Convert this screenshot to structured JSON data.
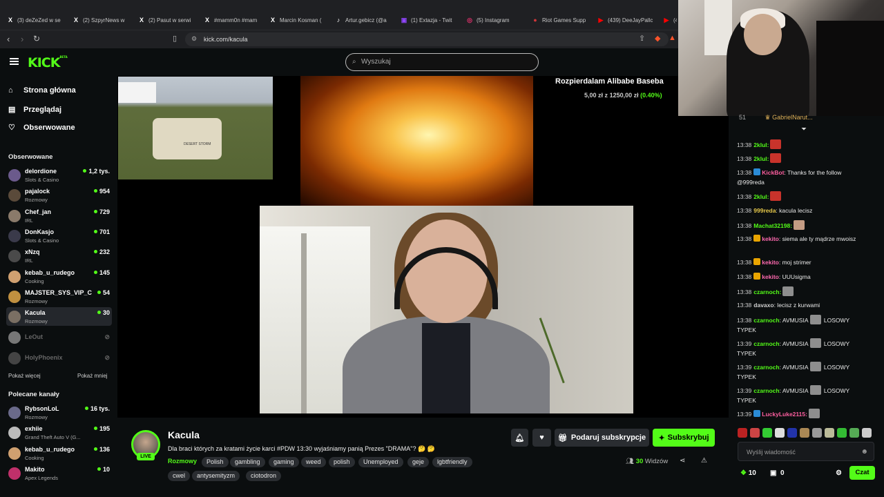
{
  "browser": {
    "tabs": [
      {
        "icon": "X",
        "label": "(3) deZeZed w se"
      },
      {
        "icon": "X",
        "label": "(2) SzpyrNews w"
      },
      {
        "icon": "X",
        "label": "(2) Pasut w serwi"
      },
      {
        "icon": "X",
        "label": "#mamm0n #mam"
      },
      {
        "icon": "X",
        "label": "Marcin Kosman ("
      },
      {
        "icon": "♪",
        "label": "Artur.gebicz (@a"
      },
      {
        "icon": "▣",
        "label": "(1) Extazja - Twit"
      },
      {
        "icon": "◎",
        "label": "(5) Instagram"
      },
      {
        "icon": "●",
        "label": "Riot Games Supp"
      },
      {
        "icon": "▶",
        "label": "(439) DeeJayPallc"
      },
      {
        "icon": "▶",
        "label": "(4"
      }
    ],
    "url": "kick.com/kacula"
  },
  "header": {
    "logo": "KICK",
    "logo_sup": "BETA",
    "search_placeholder": "Wyszukaj"
  },
  "sidebar": {
    "nav": [
      {
        "icon": "⌂",
        "label": "Strona główna"
      },
      {
        "icon": "▤",
        "label": "Przeglądaj"
      },
      {
        "icon": "♡",
        "label": "Obserwowane"
      }
    ],
    "followed_header": "Obserwowane",
    "followed": [
      {
        "name": "delordione",
        "category": "Slots & Casino",
        "viewers": "1,2 tys.",
        "color": "#6b5a8c"
      },
      {
        "name": "pajalock",
        "category": "Rozmowy",
        "viewers": "954",
        "color": "#5a4a3a"
      },
      {
        "name": "Chef_jan",
        "category": "IRL",
        "viewers": "729",
        "color": "#8a7a6a"
      },
      {
        "name": "DonKasjo",
        "category": "Slots & Casino",
        "viewers": "701",
        "color": "#3a3a4a"
      },
      {
        "name": "xNzq",
        "category": "IRL",
        "viewers": "232",
        "color": "#4a4a4a"
      },
      {
        "name": "kebab_u_rudego",
        "category": "Cooking",
        "viewers": "145",
        "color": "#d0a070"
      },
      {
        "name": "MAJSTER_SYS_VIP_C",
        "category": "Rozmowy",
        "viewers": "54",
        "color": "#c09040"
      },
      {
        "name": "Kacula",
        "category": "Rozmowy",
        "viewers": "30",
        "color": "#7a6f63"
      }
    ],
    "offline": [
      {
        "name": "LeOut",
        "color": "#777"
      },
      {
        "name": "HolyPhoenix",
        "color": "#444"
      }
    ],
    "show_more": "Pokaż więcej",
    "show_less": "Pokaż mniej",
    "recommended_header": "Polecane kanały",
    "recommended": [
      {
        "name": "RybsonLoL",
        "category": "Rozmowy",
        "viewers": "16 tys.",
        "color": "#6a6a8a"
      },
      {
        "name": "exhiie",
        "category": "Grand Theft Auto V (G...",
        "viewers": "195",
        "color": "#bbb"
      },
      {
        "name": "kebab_u_rudego",
        "category": "Cooking",
        "viewers": "136",
        "color": "#d0a070"
      },
      {
        "name": "Makito",
        "category": "Apex Legends",
        "viewers": "10",
        "color": "#c0306a"
      }
    ]
  },
  "overlay": {
    "donation_title": "Rozpierdalam Alibabe Baseba",
    "donation_amount": "5,00 zł",
    "donation_z": "z",
    "donation_goal": "1250,00 zł",
    "donation_pct": "(0.40%)",
    "donation_progress": 0.004,
    "tank_label": "DESERT STORM"
  },
  "streamer": {
    "name": "Kacula",
    "live": "LIVE",
    "title": "Dla braci których za kratami życie karci #PDW 13:30 wyjaśniamy panią Prezes \"DRAMA\"? 🤔 🤔",
    "category": "Rozmowy",
    "tags": [
      "Polish",
      "gambling",
      "gaming",
      "weed",
      "polish",
      "Unemployed",
      "geje",
      "lgbtfriendly",
      "cwel",
      "antysemityzm",
      "ciotodron"
    ],
    "viewers_count": "30",
    "viewers_label": "Widzów",
    "gift_label": "Podaruj subskrypcje",
    "sub_label": "Subskrybuj"
  },
  "chat": {
    "pinned_user": "GabrielNarut...",
    "pinned_count": "51",
    "messages": [
      {
        "time": "13:38",
        "user": "2klul:",
        "color": "#53fc18",
        "text": "",
        "emote": "red"
      },
      {
        "time": "13:38",
        "user": "2klul:",
        "color": "#53fc18",
        "text": "",
        "emote": "red"
      },
      {
        "time": "13:38",
        "user": "KickBot",
        "color": "#ff5fa0",
        "text": ": Thanks for the follow @999reda",
        "emote": ""
      },
      {
        "time": "13:38",
        "user": "2klul:",
        "color": "#53fc18",
        "text": "",
        "emote": "red"
      },
      {
        "time": "13:38",
        "user": "999reda",
        "color": "#e6c84a",
        "text": ": kacula lecisz",
        "emote": ""
      },
      {
        "time": "13:38",
        "user": "Machat32198:",
        "color": "#53fc18",
        "text": "",
        "emote": "skin"
      },
      {
        "time": "13:38",
        "user": "kekito",
        "color": "#ff6ab0",
        "text": ": siema ale ty mądrze mwoisz",
        "emote": ""
      },
      {
        "time": "13:38",
        "user": "kekito",
        "color": "#ff6ab0",
        "text": ": moj strimer",
        "emote": ""
      },
      {
        "time": "13:38",
        "user": "kekito",
        "color": "#ff6ab0",
        "text": ": UUUsigma",
        "emote": ""
      },
      {
        "time": "13:38",
        "user": "czarnoch:",
        "color": "#53fc18",
        "text": "",
        "emote": "gray"
      },
      {
        "time": "13:38",
        "user": "davaxo",
        "color": "#cfcfcf",
        "text": ": lecisz z kurwami",
        "emote": ""
      },
      {
        "time": "13:38",
        "user": "czarnoch",
        "color": "#53fc18",
        "text": ": AVMUSIA",
        "emote": "gray",
        "tail": "LOSOWY TYPEK"
      },
      {
        "time": "13:39",
        "user": "czarnoch",
        "color": "#53fc18",
        "text": ": AVMUSIA",
        "emote": "gray",
        "tail": "LOSOWY TYPEK"
      },
      {
        "time": "13:39",
        "user": "czarnoch",
        "color": "#53fc18",
        "text": ": AVMUSIA",
        "emote": "gray",
        "tail": "LOSOWY TYPEK"
      },
      {
        "time": "13:39",
        "user": "czarnoch",
        "color": "#53fc18",
        "text": ": AVMUSIA",
        "emote": "gray",
        "tail": "LOSOWY TYPEK"
      },
      {
        "time": "13:39",
        "user": "LuckyLuke2115:",
        "color": "#ff5fa0",
        "text": "",
        "emote": "gray"
      }
    ],
    "input_placeholder": "Wyślij wiadomość",
    "points": "10",
    "bag": "0",
    "send_label": "Czat"
  },
  "colors": {
    "accent": "#53fc18",
    "bg": "#0b0e0f"
  }
}
